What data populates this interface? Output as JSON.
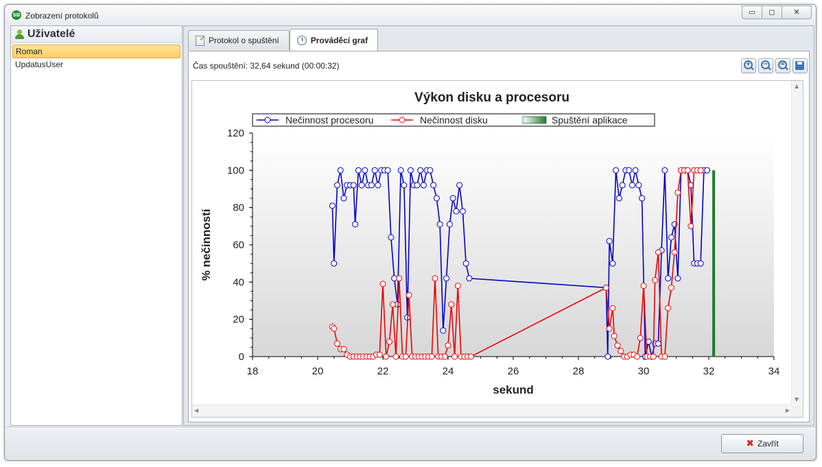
{
  "window": {
    "title": "Zobrazení protokolů",
    "app_icon_label": "SD",
    "controls": {
      "minimize": "▭",
      "maximize": "◻",
      "close": "✕"
    }
  },
  "left_panel": {
    "title": "Uživatelé",
    "users": [
      {
        "name": "Roman",
        "selected": true
      },
      {
        "name": "UpdatusUser",
        "selected": false
      }
    ]
  },
  "tabs": [
    {
      "label": "Protokol o spuštění",
      "active": false,
      "icon": "document-edit-icon"
    },
    {
      "label": "Prováděcí graf",
      "active": true,
      "icon": "clock-icon"
    }
  ],
  "run_time": "Čas spouštění: 32,64 sekund (00:00:32)",
  "zoom_toolbar": [
    {
      "name": "zoom-in-button",
      "symbol": "+"
    },
    {
      "name": "zoom-out-button",
      "symbol": "−"
    },
    {
      "name": "zoom-reset-button",
      "symbol": "="
    },
    {
      "name": "save-chart-button",
      "symbol": ""
    }
  ],
  "footer": {
    "close_label": "Zavřít",
    "close_icon": "✖"
  },
  "chart_data": {
    "type": "line",
    "title": "Výkon disku a procesoru",
    "xlabel": "sekund",
    "ylabel": "% nečinnosti",
    "xlim": [
      18,
      34
    ],
    "ylim": [
      0,
      120
    ],
    "xticks": [
      18,
      20,
      22,
      24,
      26,
      28,
      30,
      32,
      34
    ],
    "yticks": [
      0,
      20,
      40,
      60,
      80,
      100,
      120
    ],
    "grid": false,
    "legend_placement": "top-center",
    "series": [
      {
        "name": "Nečinnost procesoru",
        "color": "#0000cc",
        "points": [
          [
            20.45,
            81
          ],
          [
            20.5,
            50
          ],
          [
            20.6,
            92
          ],
          [
            20.7,
            100
          ],
          [
            20.8,
            85
          ],
          [
            20.9,
            92
          ],
          [
            21.0,
            92
          ],
          [
            21.1,
            92
          ],
          [
            21.15,
            71
          ],
          [
            21.25,
            100
          ],
          [
            21.35,
            92
          ],
          [
            21.45,
            100
          ],
          [
            21.55,
            92
          ],
          [
            21.65,
            92
          ],
          [
            21.75,
            100
          ],
          [
            21.85,
            92
          ],
          [
            21.95,
            100
          ],
          [
            22.05,
            100
          ],
          [
            22.15,
            100
          ],
          [
            22.25,
            64
          ],
          [
            22.35,
            42
          ],
          [
            22.45,
            28
          ],
          [
            22.55,
            100
          ],
          [
            22.65,
            92
          ],
          [
            22.75,
            21
          ],
          [
            22.85,
            100
          ],
          [
            22.95,
            92
          ],
          [
            23.05,
            92
          ],
          [
            23.15,
            100
          ],
          [
            23.25,
            92
          ],
          [
            23.35,
            100
          ],
          [
            23.45,
            100
          ],
          [
            23.55,
            92
          ],
          [
            23.65,
            85
          ],
          [
            23.75,
            71
          ],
          [
            23.85,
            14
          ],
          [
            23.95,
            42
          ],
          [
            24.05,
            71
          ],
          [
            24.15,
            85
          ],
          [
            24.25,
            78
          ],
          [
            24.35,
            92
          ],
          [
            24.45,
            78
          ],
          [
            24.55,
            50
          ],
          [
            24.65,
            42
          ],
          [
            28.85,
            37
          ],
          [
            28.9,
            0
          ],
          [
            28.95,
            62
          ],
          [
            29.05,
            50
          ],
          [
            29.15,
            100
          ],
          [
            29.25,
            85
          ],
          [
            29.35,
            92
          ],
          [
            29.45,
            100
          ],
          [
            29.55,
            100
          ],
          [
            29.65,
            92
          ],
          [
            29.75,
            100
          ],
          [
            29.85,
            92
          ],
          [
            29.95,
            85
          ],
          [
            30.05,
            0
          ],
          [
            30.15,
            8
          ],
          [
            30.25,
            0
          ],
          [
            30.35,
            7
          ],
          [
            30.45,
            7
          ],
          [
            30.55,
            57
          ],
          [
            30.65,
            100
          ],
          [
            30.75,
            42
          ],
          [
            30.85,
            64
          ],
          [
            30.95,
            71
          ],
          [
            31.05,
            42
          ],
          [
            31.15,
            100
          ],
          [
            31.25,
            100
          ],
          [
            31.35,
            100
          ],
          [
            31.45,
            92
          ],
          [
            31.55,
            50
          ],
          [
            31.65,
            50
          ],
          [
            31.75,
            50
          ],
          [
            31.85,
            100
          ],
          [
            31.95,
            100
          ]
        ]
      },
      {
        "name": "Nečinnost disku",
        "color": "#ee0000",
        "points": [
          [
            20.45,
            16
          ],
          [
            20.5,
            15
          ],
          [
            20.6,
            7
          ],
          [
            20.7,
            4
          ],
          [
            20.8,
            4
          ],
          [
            20.9,
            1
          ],
          [
            21.0,
            0
          ],
          [
            21.1,
            0
          ],
          [
            21.2,
            0
          ],
          [
            21.3,
            0
          ],
          [
            21.4,
            0
          ],
          [
            21.5,
            0
          ],
          [
            21.6,
            0
          ],
          [
            21.7,
            0
          ],
          [
            21.8,
            1
          ],
          [
            21.9,
            1
          ],
          [
            22.0,
            39
          ],
          [
            22.1,
            0
          ],
          [
            22.2,
            8
          ],
          [
            22.3,
            28
          ],
          [
            22.4,
            0
          ],
          [
            22.5,
            42
          ],
          [
            22.6,
            0
          ],
          [
            22.7,
            0
          ],
          [
            22.8,
            33
          ],
          [
            22.9,
            0
          ],
          [
            23.0,
            0
          ],
          [
            23.1,
            0
          ],
          [
            23.2,
            0
          ],
          [
            23.3,
            0
          ],
          [
            23.4,
            0
          ],
          [
            23.5,
            0
          ],
          [
            23.6,
            42
          ],
          [
            23.7,
            0
          ],
          [
            23.8,
            0
          ],
          [
            23.9,
            0
          ],
          [
            24.0,
            6
          ],
          [
            24.1,
            28
          ],
          [
            24.2,
            0
          ],
          [
            24.3,
            38
          ],
          [
            24.4,
            0
          ],
          [
            24.5,
            0
          ],
          [
            24.6,
            0
          ],
          [
            24.7,
            0
          ],
          [
            28.85,
            37
          ],
          [
            28.95,
            15
          ],
          [
            29.05,
            26
          ],
          [
            29.1,
            11
          ],
          [
            29.2,
            6
          ],
          [
            29.3,
            3
          ],
          [
            29.4,
            0
          ],
          [
            29.5,
            0
          ],
          [
            29.6,
            1
          ],
          [
            29.7,
            1
          ],
          [
            29.8,
            0
          ],
          [
            29.9,
            10
          ],
          [
            30.0,
            38
          ],
          [
            30.1,
            0
          ],
          [
            30.2,
            0
          ],
          [
            30.3,
            0
          ],
          [
            30.35,
            41
          ],
          [
            30.45,
            56
          ],
          [
            30.55,
            0
          ],
          [
            30.65,
            0
          ],
          [
            30.75,
            26
          ],
          [
            30.85,
            37
          ],
          [
            30.95,
            56
          ],
          [
            31.05,
            88
          ],
          [
            31.15,
            100
          ],
          [
            31.25,
            100
          ],
          [
            31.35,
            100
          ],
          [
            31.45,
            70
          ],
          [
            31.55,
            100
          ],
          [
            31.65,
            100
          ],
          [
            31.75,
            100
          ]
        ]
      }
    ],
    "markers": [
      {
        "name": "Spuštění aplikace",
        "color": "#1f7a2e",
        "x": 32.15,
        "y": 100
      }
    ]
  }
}
